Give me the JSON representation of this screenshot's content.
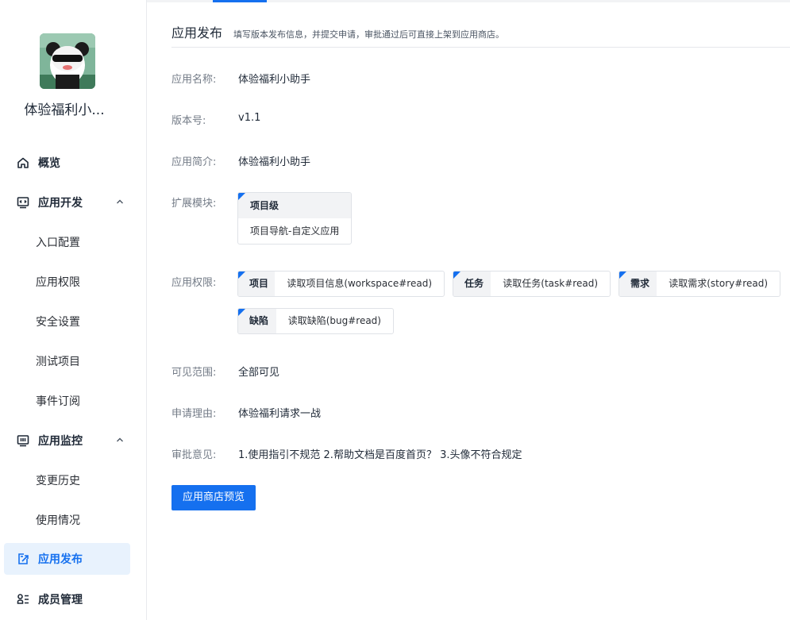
{
  "app": {
    "name": "体验福利小..."
  },
  "sidebar": {
    "items": [
      {
        "label": "概览",
        "icon": "home-icon"
      },
      {
        "label": "应用开发",
        "icon": "code-monitor-icon"
      },
      {
        "label": "入口配置"
      },
      {
        "label": "应用权限"
      },
      {
        "label": "安全设置"
      },
      {
        "label": "测试项目"
      },
      {
        "label": "事件订阅"
      },
      {
        "label": "应用监控",
        "icon": "monitor-icon"
      },
      {
        "label": "变更历史"
      },
      {
        "label": "使用情况"
      },
      {
        "label": "应用发布",
        "icon": "publish-icon"
      },
      {
        "label": "成员管理",
        "icon": "members-icon"
      }
    ]
  },
  "header": {
    "title": "应用发布",
    "description": "填写版本发布信息，并提交申请，审批通过后可直接上架到应用商店。"
  },
  "form": {
    "name_label": "应用名称:",
    "name_value": "体验福利小助手",
    "version_label": "版本号:",
    "version_value": "v1.1",
    "intro_label": "应用简介:",
    "intro_value": "体验福利小助手",
    "modules_label": "扩展模块:",
    "module_title": "项目级",
    "module_item": "项目导航-自定义应用",
    "perms_label": "应用权限:",
    "perms": [
      {
        "key": "项目",
        "value": "读取项目信息(workspace#read)"
      },
      {
        "key": "任务",
        "value": "读取任务(task#read)"
      },
      {
        "key": "需求",
        "value": "读取需求(story#read)"
      },
      {
        "key": "缺陷",
        "value": "读取缺陷(bug#read)"
      }
    ],
    "scope_label": "可见范围:",
    "scope_value": "全部可见",
    "reason_label": "申请理由:",
    "reason_value": "体验福利请求一战",
    "review_label": "审批意见:",
    "review_value": "1.使用指引不规范 2.帮助文档是百度首页？ 3.头像不符合规定"
  },
  "actions": {
    "preview_label": "应用商店预览"
  },
  "colors": {
    "accent": "#1570ef",
    "active_bg": "#e8f2fd"
  }
}
